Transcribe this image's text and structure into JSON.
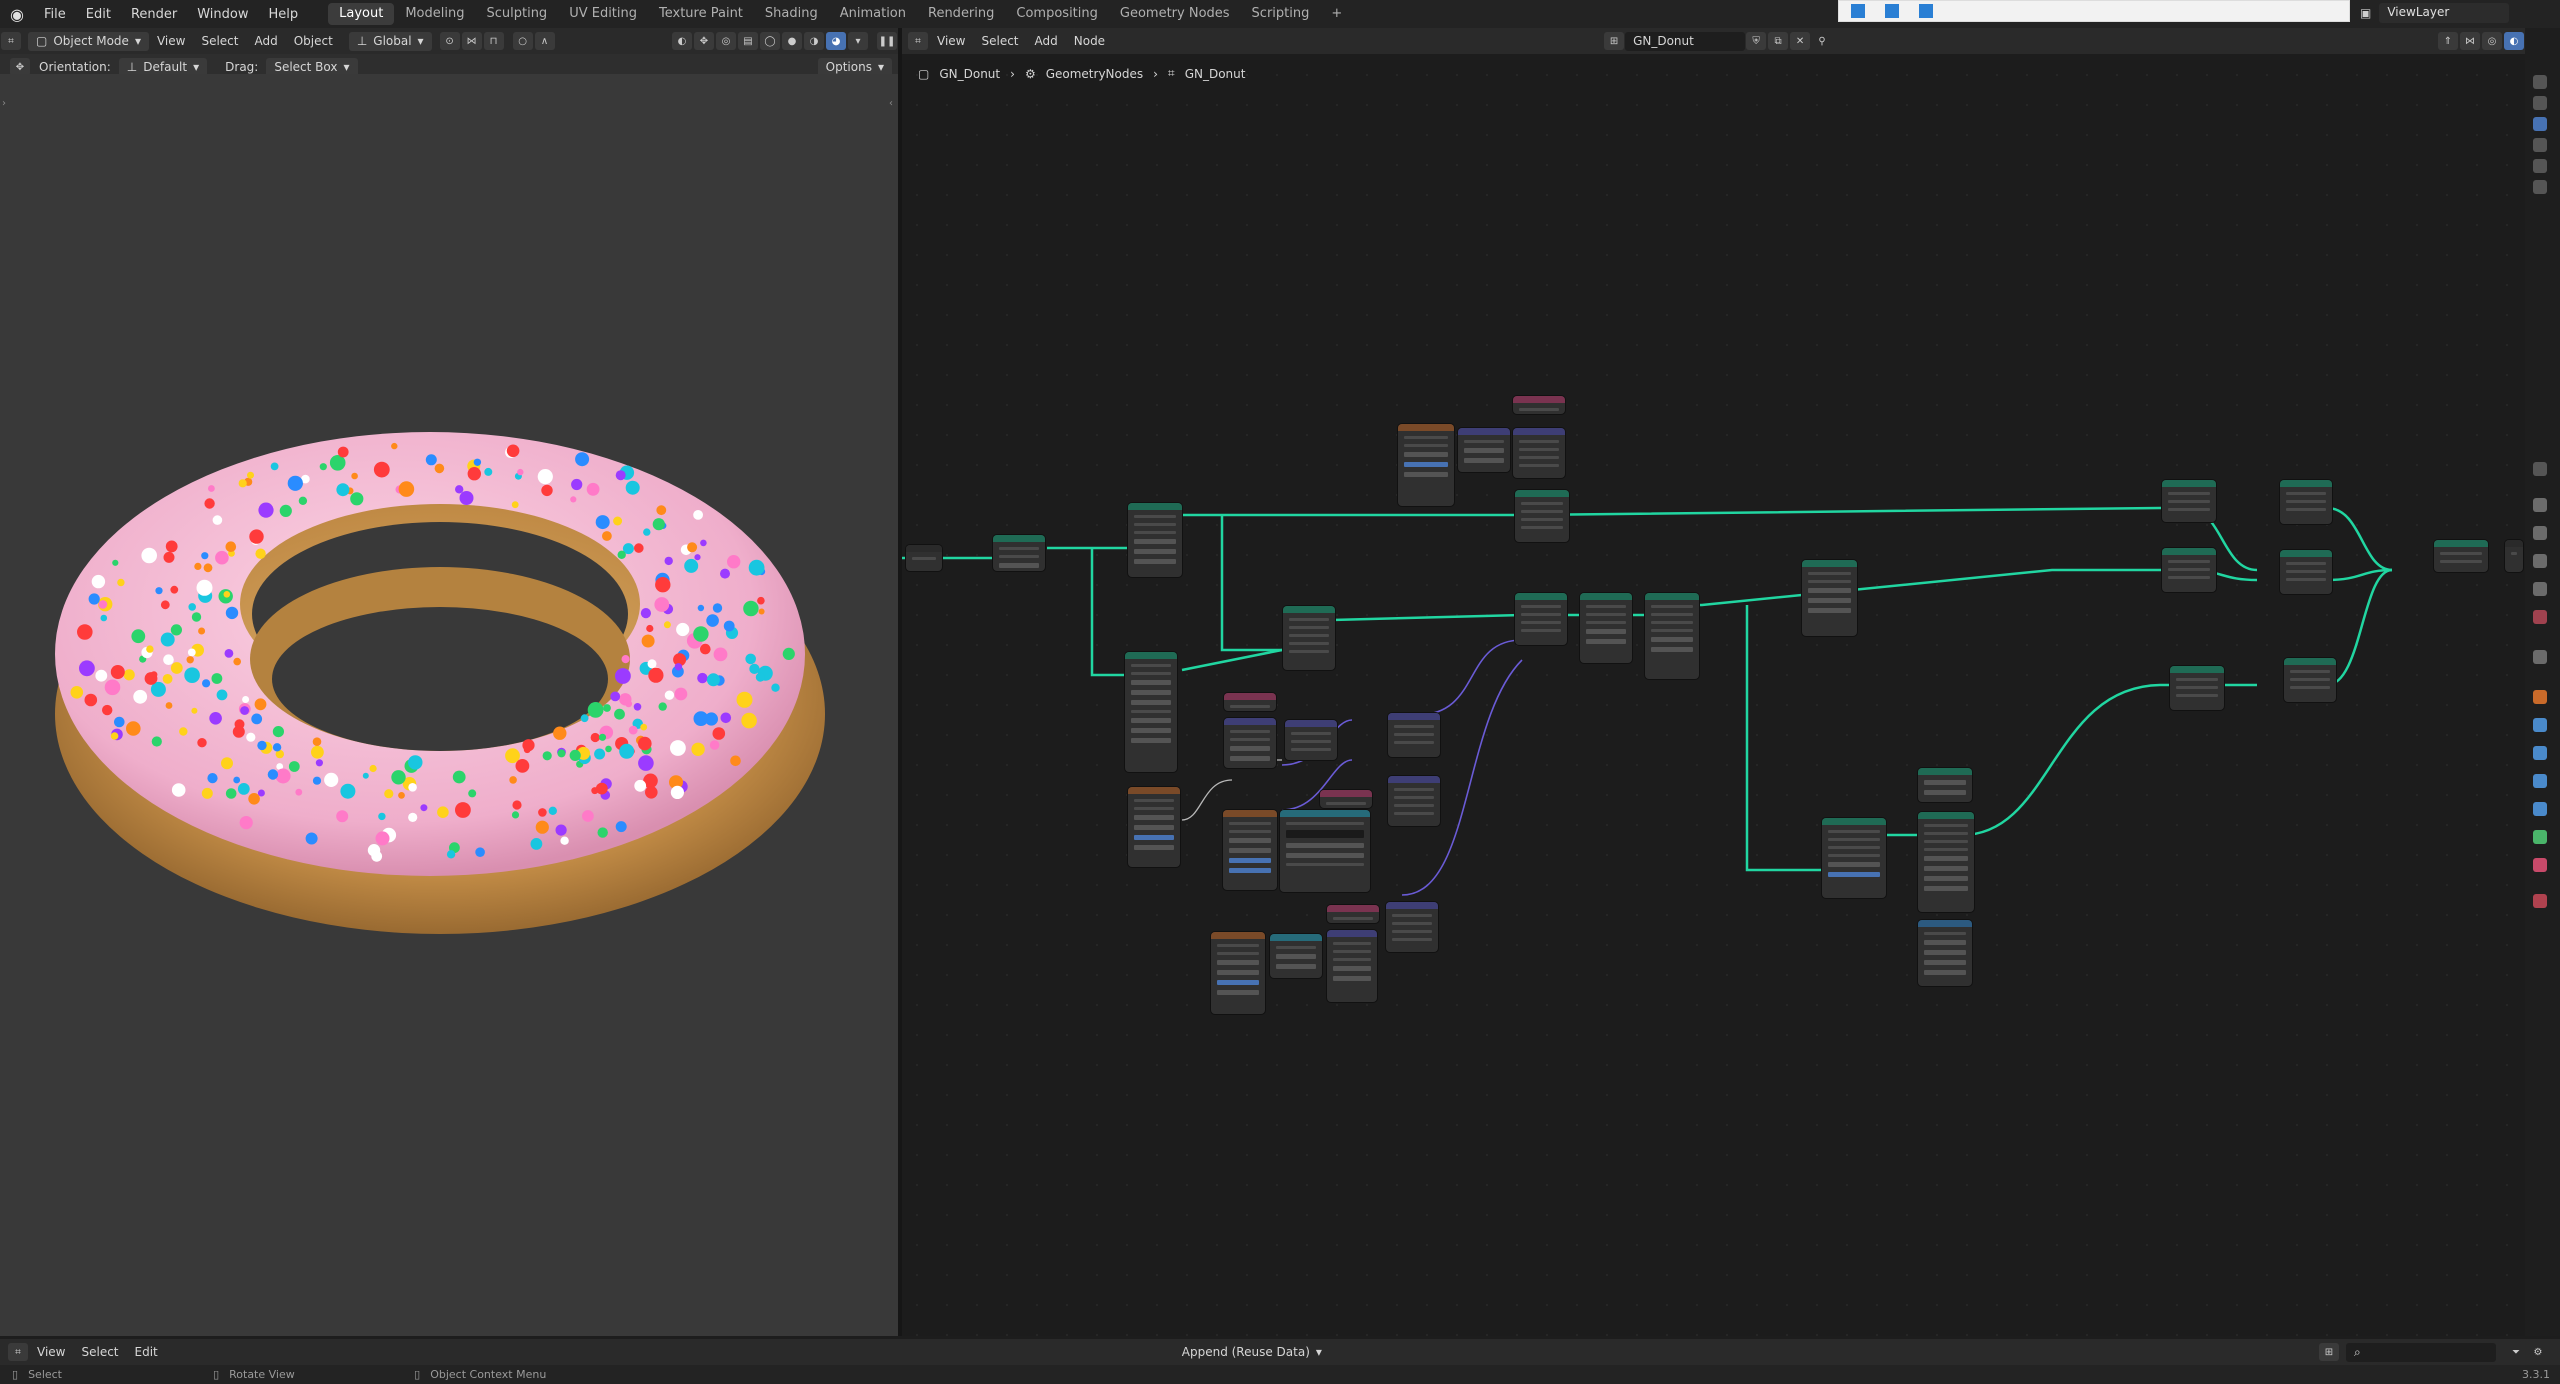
{
  "top_menu": [
    "File",
    "Edit",
    "Render",
    "Window",
    "Help"
  ],
  "workspaces": [
    "Layout",
    "Modeling",
    "Sculpting",
    "UV Editing",
    "Texture Paint",
    "Shading",
    "Animation",
    "Rendering",
    "Compositing",
    "Geometry Nodes",
    "Scripting"
  ],
  "active_workspace": "Layout",
  "view_layer": "ViewLayer",
  "viewport": {
    "mode": "Object Mode",
    "menus": [
      "View",
      "Select",
      "Add",
      "Object"
    ],
    "transform_orientation": "Global",
    "orientation_label": "Orientation:",
    "orientation_value": "Default",
    "drag_label": "Drag:",
    "drag_value": "Select Box",
    "options": "Options"
  },
  "node_editor": {
    "menus": [
      "View",
      "Select",
      "Add",
      "Node"
    ],
    "node_group": "GN_Donut",
    "breadcrumb": [
      "GN_Donut",
      "GeometryNodes",
      "GN_Donut"
    ]
  },
  "bottom_bar": {
    "menus": [
      "View",
      "Select",
      "Edit"
    ],
    "append_mode": "Append (Reuse Data)"
  },
  "status_bar": {
    "hints": [
      "Select",
      "Rotate View",
      "Object Context Menu"
    ],
    "version": "3.3.1"
  },
  "colors": {
    "accent": "#4772b3",
    "geometry_wire": "#21d6a1",
    "vector_wire": "#6a5bd6",
    "float_wire": "#9a9a9a",
    "icing": "#f0b4cf",
    "dough": "#c89a55"
  },
  "icons": [
    "blender-logo",
    "object-mode-icon",
    "global-orientation-icon",
    "snap-icon",
    "proportional-icon",
    "overlay-icon",
    "shading-solid-icon",
    "shading-material-icon",
    "shading-render-icon",
    "node-tree-icon",
    "pin-icon",
    "filter-icon",
    "search-icon",
    "gear-icon"
  ]
}
